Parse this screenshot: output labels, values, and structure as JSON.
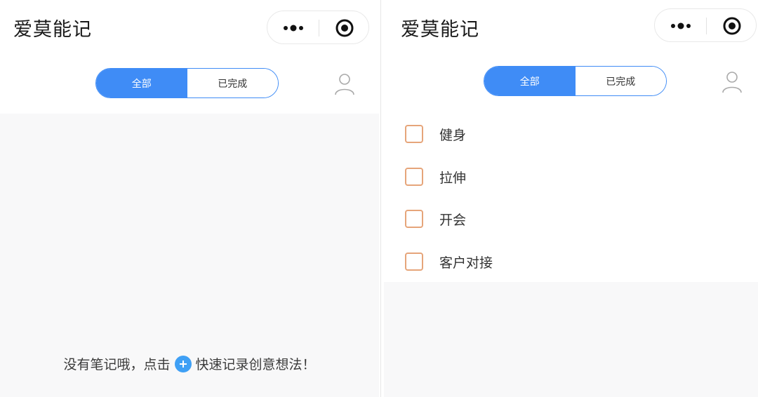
{
  "app": {
    "title": "爱莫能记"
  },
  "tabs": {
    "all": "全部",
    "done": "已完成"
  },
  "colors": {
    "accent": "#3f8cf6",
    "checkbox_border": "#e6a57a",
    "plus": "#3fa0f5"
  },
  "icons": {
    "more": "more-dots-icon",
    "close": "target-icon",
    "user": "user-icon",
    "add": "plus-icon"
  },
  "left_panel": {
    "empty_message_before": "没有笔记哦，点击",
    "empty_message_after": "快速记录创意想法！"
  },
  "right_panel": {
    "todos": [
      {
        "label": "健身",
        "checked": false
      },
      {
        "label": "拉伸",
        "checked": false
      },
      {
        "label": "开会",
        "checked": false
      },
      {
        "label": "客户对接",
        "checked": false
      }
    ]
  }
}
